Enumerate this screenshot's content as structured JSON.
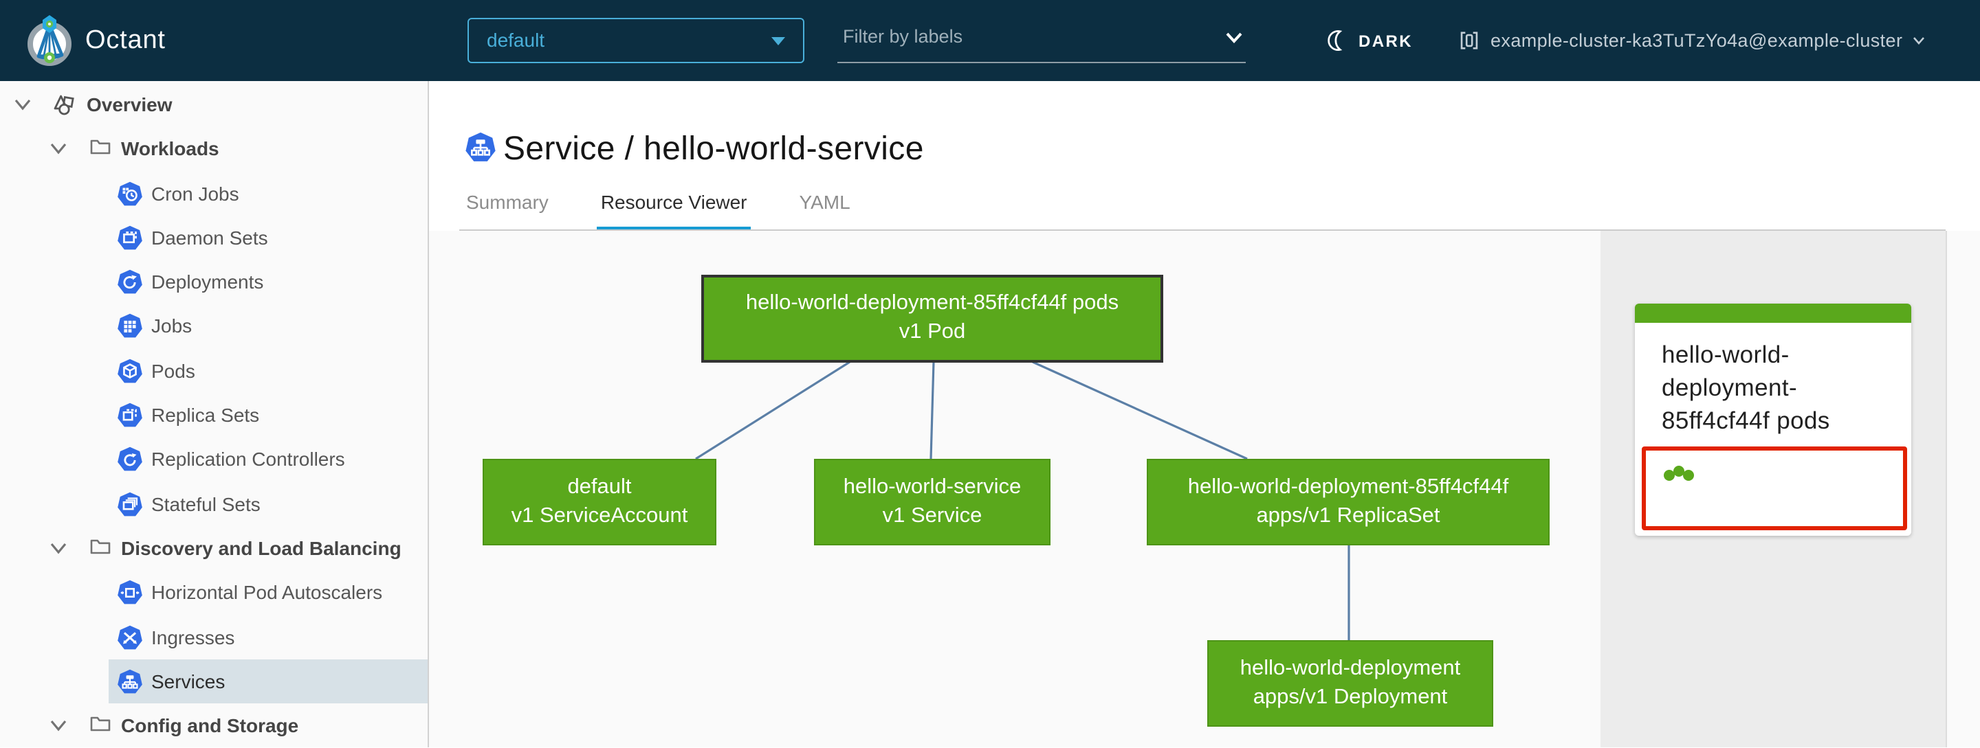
{
  "header": {
    "app_title": "Octant",
    "namespace_selector": {
      "value": "default"
    },
    "filter": {
      "placeholder": "Filter by labels"
    },
    "theme_toggle": {
      "label": "DARK"
    },
    "cluster": {
      "label": "example-cluster-ka3TuTzYo4a@example-cluster"
    }
  },
  "sidebar": {
    "items": [
      {
        "label": "Overview",
        "level": 0,
        "icon": "objects",
        "expanded": true
      },
      {
        "label": "Workloads",
        "level": 1,
        "icon": "folder",
        "expanded": true
      },
      {
        "label": "Cron Jobs",
        "level": 2,
        "icon": "k8s-cronjob"
      },
      {
        "label": "Daemon Sets",
        "level": 2,
        "icon": "k8s-daemonset"
      },
      {
        "label": "Deployments",
        "level": 2,
        "icon": "k8s-deployment"
      },
      {
        "label": "Jobs",
        "level": 2,
        "icon": "k8s-job"
      },
      {
        "label": "Pods",
        "level": 2,
        "icon": "k8s-pod"
      },
      {
        "label": "Replica Sets",
        "level": 2,
        "icon": "k8s-replicaset"
      },
      {
        "label": "Replication Controllers",
        "level": 2,
        "icon": "k8s-replicationcontroller"
      },
      {
        "label": "Stateful Sets",
        "level": 2,
        "icon": "k8s-statefulset"
      },
      {
        "label": "Discovery and Load Balancing",
        "level": 1,
        "icon": "folder",
        "expanded": true
      },
      {
        "label": "Horizontal Pod Autoscalers",
        "level": 2,
        "icon": "k8s-hpa"
      },
      {
        "label": "Ingresses",
        "level": 2,
        "icon": "k8s-ingress"
      },
      {
        "label": "Services",
        "level": 2,
        "icon": "k8s-service",
        "selected": true
      },
      {
        "label": "Config and Storage",
        "level": 1,
        "icon": "folder",
        "expanded": true
      }
    ]
  },
  "main": {
    "title": "Service / hello-world-service",
    "tabs": [
      {
        "label": "Summary",
        "active": false
      },
      {
        "label": "Resource Viewer",
        "active": true
      },
      {
        "label": "YAML",
        "active": false
      }
    ]
  },
  "graph": {
    "nodes": [
      {
        "id": "pod",
        "line1": "hello-world-deployment-85ff4cf44f pods",
        "line2": "v1 Pod",
        "selected": true
      },
      {
        "id": "serviceaccount",
        "line1": "default",
        "line2": "v1 ServiceAccount",
        "selected": false
      },
      {
        "id": "service",
        "line1": "hello-world-service",
        "line2": "v1 Service",
        "selected": false
      },
      {
        "id": "replicaset",
        "line1": "hello-world-deployment-85ff4cf44f",
        "line2": "apps/v1 ReplicaSet",
        "selected": false
      },
      {
        "id": "deployment",
        "line1": "hello-world-deployment",
        "line2": "apps/v1 Deployment",
        "selected": false
      }
    ],
    "edges": [
      [
        "pod",
        "serviceaccount"
      ],
      [
        "pod",
        "service"
      ],
      [
        "pod",
        "replicaset"
      ],
      [
        "replicaset",
        "deployment"
      ]
    ]
  },
  "panel": {
    "card": {
      "title": "hello-world-deployment-85ff4cf44f pods",
      "status_dot_count": 3
    }
  },
  "colors": {
    "header_bg": "#0c2e41",
    "accent_blue": "#49afd9",
    "k8s_icon_blue": "#326ce5",
    "node_green": "#5aa81c",
    "edge_blue": "#5b7fa6",
    "selection_red": "#e12200",
    "tab_underline": "#179bd3",
    "sidebar_selected_bg": "#d7e1e7"
  }
}
